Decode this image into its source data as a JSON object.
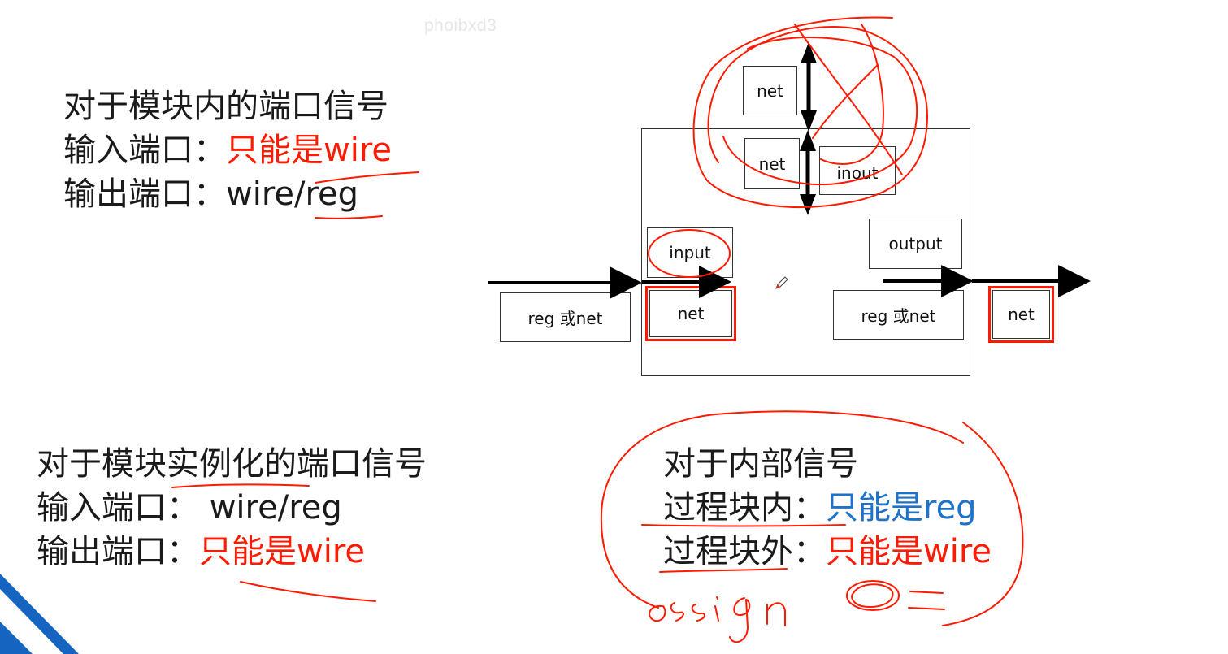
{
  "watermark": "phoibxd3",
  "rules_module_ports": {
    "title": "对于模块内的端口信号",
    "input_label": "输入端口：",
    "input_value": "只能是wire",
    "output_label": "输出端口：",
    "output_value": "wire/reg"
  },
  "rules_instance_ports": {
    "title": "对于模块实例化的端口信号",
    "input_label": "输入端口：",
    "input_value": " wire/reg",
    "output_label": "输出端口：",
    "output_value": "只能是wire"
  },
  "rules_internal": {
    "title": "对于内部信号",
    "inside_label": "过程块内：",
    "inside_value": "只能是reg",
    "outside_label": "过程块外：",
    "outside_value": "只能是wire"
  },
  "diagram": {
    "top_net": "net",
    "inner_net": "net",
    "inout": "inout",
    "input": "input",
    "output": "output",
    "input_side_source": "reg 或net",
    "input_port_net": "net",
    "output_side_source": "reg 或net",
    "output_dest_net": "net"
  },
  "colors": {
    "accent_red": "#ff1a00",
    "accent_blue": "#1f72c9",
    "corner_blue": "#1565c0"
  },
  "icons": {
    "cursor": "pen-cursor-icon"
  }
}
